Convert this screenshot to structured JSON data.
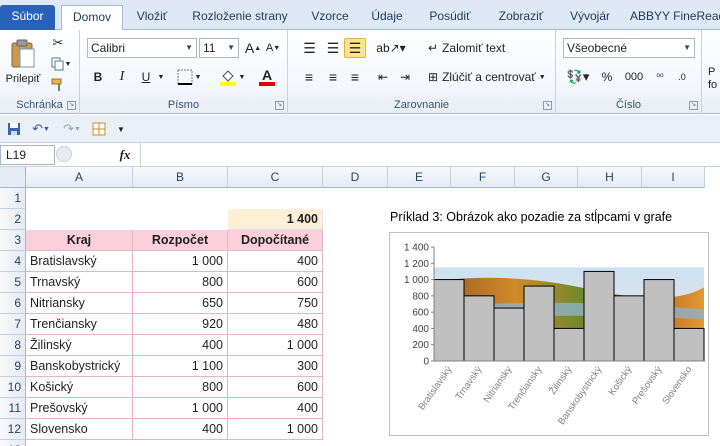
{
  "ribbon_tabs": [
    "Súbor",
    "Domov",
    "Vložiť",
    "Rozloženie strany",
    "Vzorce",
    "Údaje",
    "Posúdiť",
    "Zobraziť",
    "Vývojár",
    "ABBYY FineRead"
  ],
  "clipboard": {
    "paste_label": "Prilepiť",
    "group_label": "Schránka"
  },
  "font": {
    "name": "Calibri",
    "size": "11",
    "group_label": "Písmo",
    "bold": "B",
    "italic": "I",
    "underline": "U",
    "grow": "A",
    "shrink": "A",
    "font_color_letter": "A"
  },
  "alignment": {
    "group_label": "Zarovnanie",
    "wrap_text": "Zalomiť text",
    "merge_center": "Zlúčiť a centrovať"
  },
  "number": {
    "group_label": "Číslo",
    "format": "Všeobecné",
    "percent": "%",
    "thousands": "000"
  },
  "next_group_partial": "P fo",
  "formula_bar": {
    "name_box": "L19",
    "fx": "fx",
    "formula": ""
  },
  "columns": [
    "A",
    "B",
    "C",
    "D",
    "E",
    "F",
    "G",
    "H",
    "I"
  ],
  "rows": [
    "1",
    "2",
    "3",
    "4",
    "5",
    "6",
    "7",
    "8",
    "9",
    "10",
    "11",
    "12",
    "13"
  ],
  "sheet": {
    "c2": "1 400",
    "headers": [
      "Kraj",
      "Rozpočet",
      "Dopočítané"
    ],
    "table": [
      [
        "Bratislavský",
        "1 000",
        "400"
      ],
      [
        "Trnavský",
        "800",
        "600"
      ],
      [
        "Nitriansky",
        "650",
        "750"
      ],
      [
        "Trenčiansky",
        "920",
        "480"
      ],
      [
        "Žilinský",
        "400",
        "1 000"
      ],
      [
        "Banskobystrický",
        "1 100",
        "300"
      ],
      [
        "Košický",
        "800",
        "600"
      ],
      [
        "Prešovský",
        "1 000",
        "400"
      ],
      [
        "Slovensko",
        "400",
        "1 000"
      ]
    ]
  },
  "chart_data": {
    "type": "bar",
    "title": "Príklad 3: Obrázok ako pozadie za stĺpcami v grafe",
    "categories": [
      "Bratislavský",
      "Trnavský",
      "Nitriansky",
      "Trenčiansky",
      "Žilinský",
      "Banskobystrický",
      "Košický",
      "Prešovský",
      "Slovensko"
    ],
    "values": [
      1000,
      800,
      650,
      920,
      400,
      1100,
      800,
      1000,
      400
    ],
    "ylim": [
      0,
      1400
    ],
    "yticks": [
      "0",
      "200",
      "400",
      "600",
      "800",
      "1 000",
      "1 200",
      "1 400"
    ],
    "bar_color": "#c0c0c0",
    "background": "photo of autumn town on a river",
    "grid": false
  },
  "colors": {
    "file_tab": "#2a61b8",
    "header_pink": "#fbd0dc",
    "c2_highlight": "#fdf0d6"
  }
}
